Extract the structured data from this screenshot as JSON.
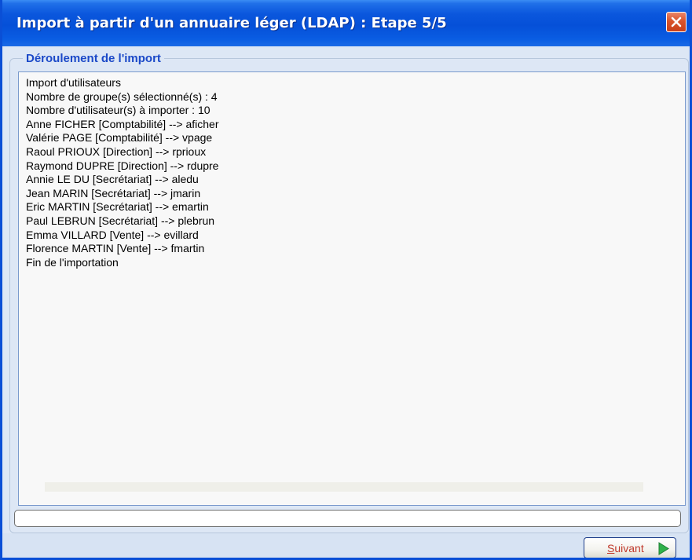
{
  "window": {
    "title": "Import à partir d'un annuaire léger (LDAP) : Etape 5/5"
  },
  "group": {
    "legend": "Déroulement de l'import"
  },
  "log": {
    "lines": [
      "Import d'utilisateurs",
      "Nombre de groupe(s) sélectionné(s) : 4",
      "Nombre d'utilisateur(s) à importer : 10",
      "Anne FICHER [Comptabilité] --> aficher",
      "Valérie PAGE [Comptabilité] --> vpage",
      "Raoul PRIOUX [Direction] --> rprioux",
      "Raymond DUPRE [Direction] --> rdupre",
      "Annie LE DU [Secrétariat] --> aledu",
      "Jean MARIN [Secrétariat] --> jmarin",
      "Eric MARTIN [Secrétariat] --> emartin",
      "Paul LEBRUN [Secrétariat] --> plebrun",
      "Emma VILLARD [Vente] --> evillard",
      "Florence MARTIN [Vente] --> fmartin",
      "Fin de l'importation"
    ]
  },
  "progress": {
    "value": 0
  },
  "buttons": {
    "next": {
      "mnemonic": "S",
      "rest": "uivant",
      "icon": "play-arrow-icon"
    },
    "close": {
      "icon": "close-icon"
    }
  },
  "colors": {
    "titlebar": "#0550d8",
    "close": "#d9542b",
    "legend": "#1b49c8",
    "next_text": "#c0392b",
    "next_arrow": "#2fb14a"
  }
}
